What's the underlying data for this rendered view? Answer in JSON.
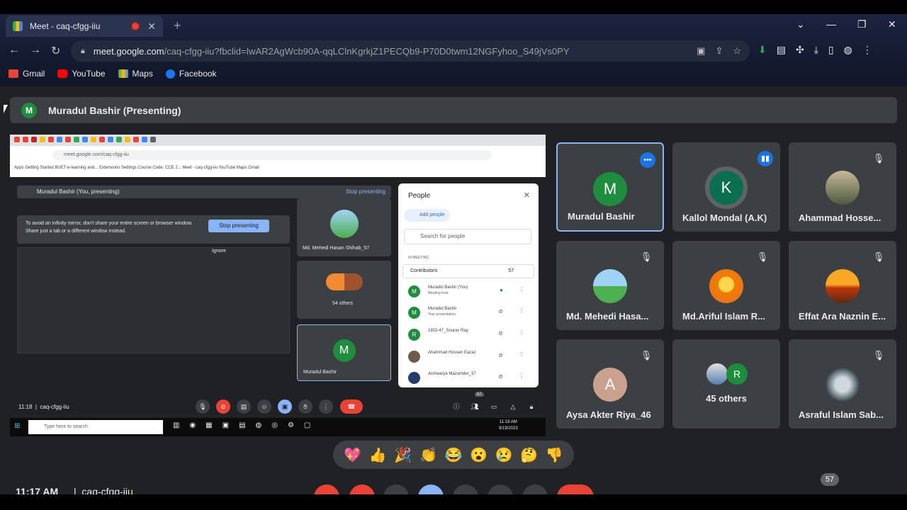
{
  "browser": {
    "tab_title": "Meet - caq-cfgg-iiu",
    "url_host": "meet.google.com",
    "url_path": "/caq-cfgg-iiu?fbclid=IwAR2AgWcb90A-qqLClnKgrkjZ1PECQb9-P70D0twm12NGFyhoo_S49jVs0PY",
    "bookmarks": [
      "Gmail",
      "YouTube",
      "Maps",
      "Facebook"
    ]
  },
  "meet": {
    "presenter_initial": "M",
    "presenter_label": "Muradul Bashir (Presenting)",
    "inner": {
      "url": "meet.google.com/caq-cfgg-iiu",
      "bookmarks": "Apps   Getting Started   BUET e-learning and...   Extensions   Settings   Course Code: CCE 2...   Meet - caq-cfgg-iiu   YouTube   Maps   Gmail",
      "banner": "Muradul Bashir (You, presenting)",
      "banner_stop": "Stop presenting",
      "warning": "To avoid an infinity mirror, don't share your entire screen or browser window. Share just a tab or a different window instead.",
      "warning_button": "Stop presenting",
      "ignore": "Ignore",
      "tile1_name": "Md. Mehedi Hasan Shihab_57",
      "tile2_name": "54 others",
      "tile3_initial": "M",
      "tile3_name": "Muradul Bashir",
      "people_title": "People",
      "add_people": "Add people",
      "search_placeholder": "Search for people",
      "in_meeting": "IN MEETING",
      "contributors": "Contributors",
      "contributors_count": "57",
      "people": [
        {
          "initial": "M",
          "name": "Muradul Bashir (You)",
          "sub": "Meeting host"
        },
        {
          "initial": "M",
          "name": "Muradul Bashir",
          "sub": "Your presentation"
        },
        {
          "initial": "R",
          "name": "1802-47_Sourav Ray",
          "sub": ""
        },
        {
          "initial": "",
          "name": "Ahammad Hossen Eazaz",
          "sub": ""
        },
        {
          "initial": "",
          "name": "Aishwarya Mazumder_37",
          "sub": ""
        }
      ],
      "time": "11:18",
      "code": "caq-cfgg-iiu",
      "badge_count": "57",
      "taskbar_search": "Type here to search",
      "taskbar_time": "11:18 AM",
      "taskbar_date": "9/19/2023"
    },
    "participants": [
      {
        "initial": "M",
        "name": "Muradul Bashir"
      },
      {
        "initial": "K",
        "name": "Kallol Mondal (A.K)"
      },
      {
        "initial": "",
        "name": "Ahammad Hosse..."
      },
      {
        "initial": "",
        "name": "Md. Mehedi Hasa..."
      },
      {
        "initial": "",
        "name": "Md.Ariful Islam R..."
      },
      {
        "initial": "",
        "name": "Effat Ara Naznin E..."
      },
      {
        "initial": "A",
        "name": "Aysa Akter Riya_46"
      },
      {
        "initial": "R",
        "name": "45 others"
      },
      {
        "initial": "",
        "name": "Asraful Islam Sab..."
      }
    ],
    "reactions": [
      "💖",
      "👍",
      "🎉",
      "👏",
      "😂",
      "😮",
      "😢",
      "🤔",
      "👎"
    ],
    "bottom": {
      "time": "11:17 AM",
      "code": "caq-cfgg-iiu",
      "participant_count": "57"
    }
  },
  "colors": {
    "accent": "#8ab4f8",
    "leave_red": "#ea4335",
    "avatar_green": "#1e8e3e",
    "tile_bg": "#3c4043"
  }
}
